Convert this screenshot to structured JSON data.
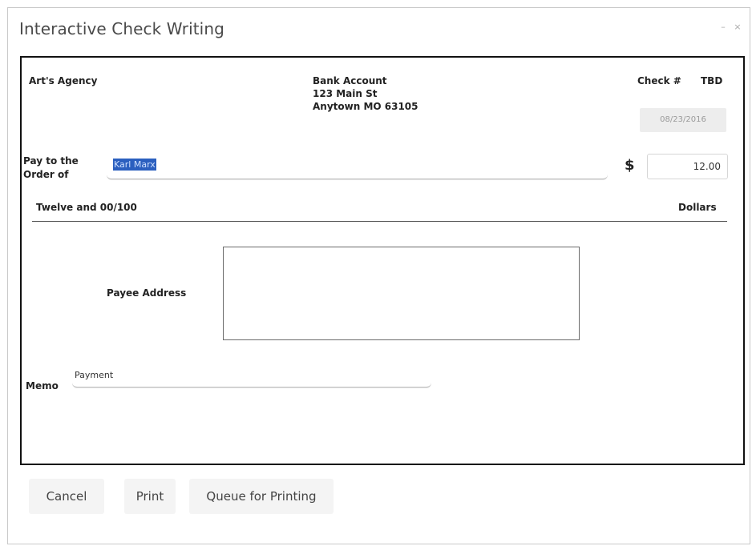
{
  "window": {
    "title": "Interactive Check Writing",
    "minimize_glyph": "–",
    "close_glyph": "×"
  },
  "check": {
    "payer_name": "Art's Agency",
    "bank": {
      "name": "Bank Account",
      "street": "123 Main St",
      "city": "Anytown MO 63105"
    },
    "check_number_label": "Check #",
    "check_number_value": "TBD",
    "date": "08/23/2016",
    "pay_to_label_line1": "Pay to the",
    "pay_to_label_line2": "Order of",
    "payee": "Karl Marx",
    "currency_symbol": "$",
    "amount": "12.00",
    "amount_words": "Twelve and 00/100",
    "dollars_label": "Dollars",
    "payee_address_label": "Payee Address",
    "payee_address_value": "",
    "memo_label": "Memo",
    "memo_value": "Payment"
  },
  "buttons": {
    "cancel": "Cancel",
    "print": "Print",
    "queue": "Queue for Printing"
  },
  "colors": {
    "selection": "#2b5fbf",
    "border": "#111111"
  }
}
